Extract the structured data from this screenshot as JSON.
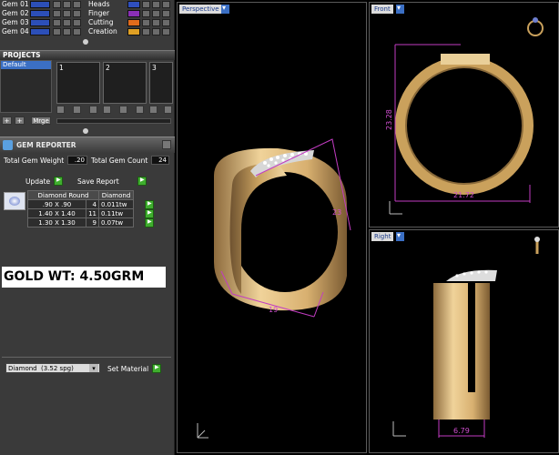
{
  "gems": [
    {
      "label": "Gem 01"
    },
    {
      "label": "Gem 02"
    },
    {
      "label": "Gem 03"
    },
    {
      "label": "Gem 04"
    }
  ],
  "materials": [
    {
      "label": "Heads",
      "color": "#2f4fbf"
    },
    {
      "label": "Finger",
      "color": "#8a2fb5"
    },
    {
      "label": "Cutting",
      "color": "#e06b1b"
    },
    {
      "label": "Creation",
      "color": "#e0a024"
    }
  ],
  "projects": {
    "title": "PROJECTS",
    "selected": "Default",
    "thumbs": [
      "1",
      "2",
      "3"
    ],
    "merge_label": "Mrge"
  },
  "gem_reporter": {
    "title": "GEM REPORTER",
    "total_weight_label": "Total Gem Weight",
    "total_weight": ".20",
    "total_count_label": "Total Gem Count",
    "total_count": "24",
    "update_label": "Update",
    "save_label": "Save Report",
    "table_headers": [
      "Diamond Round",
      "Diamond"
    ],
    "rows": [
      {
        "size": ".90 X .90",
        "count": "4",
        "wt": "0.011tw"
      },
      {
        "size": "1.40 X 1.40",
        "count": "11",
        "wt": "0.11tw"
      },
      {
        "size": "1.30 X 1.30",
        "count": "9",
        "wt": "0.07tw"
      }
    ]
  },
  "gold_weight": "GOLD WT: 4.50GRM",
  "material_select": {
    "value": "Diamond",
    "spg": "(3.52 spg)",
    "button": "Set Material"
  },
  "viewports": {
    "perspective": "Perspective",
    "front": "Front",
    "right": "Right"
  },
  "dimensions": {
    "front_height": "23.28",
    "front_width": "21.72",
    "right_width": "6.79",
    "persp_a": "23",
    "persp_b": "19"
  },
  "colors": {
    "gold_light": "#f0d39a",
    "gold_mid": "#d9b173",
    "gold_dark": "#9a7440",
    "dimension": "#c23cc2"
  }
}
